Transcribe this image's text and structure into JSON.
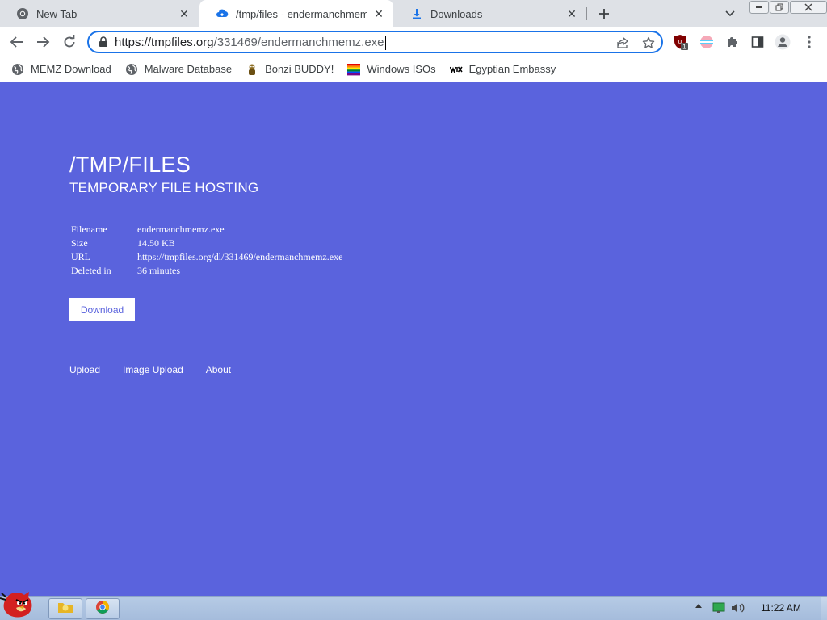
{
  "browser": {
    "tabs": [
      {
        "title": "New Tab",
        "icon": "chrome-icon"
      },
      {
        "title": "/tmp/files - endermanchmemz.exe",
        "icon": "cloud-upload-icon"
      },
      {
        "title": "Downloads",
        "icon": "download-icon"
      }
    ],
    "url_host": "https://tmpfiles.org",
    "url_path": "/331469/endermanchmemz.exe",
    "extension_badge": "1"
  },
  "bookmarks": [
    {
      "label": "MEMZ Download",
      "icon": "globe-icon"
    },
    {
      "label": "Malware Database",
      "icon": "globe-icon"
    },
    {
      "label": "Bonzi BUDDY!",
      "icon": "bonzi-icon"
    },
    {
      "label": "Windows ISOs",
      "icon": "rainbow-flag-icon"
    },
    {
      "label": "Egyptian Embassy",
      "icon": "wix-icon"
    }
  ],
  "page": {
    "title": "/TMP/FILES",
    "subtitle": "TEMPORARY FILE HOSTING",
    "file_info": [
      {
        "label": "Filename",
        "value": "endermanchmemz.exe"
      },
      {
        "label": "Size",
        "value": "14.50 KB"
      },
      {
        "label": "URL",
        "value": "https://tmpfiles.org/dl/331469/endermanchmemz.exe"
      },
      {
        "label": "Deleted in",
        "value": "36 minutes"
      }
    ],
    "download_label": "Download",
    "footer_links": [
      "Upload",
      "Image Upload",
      "About"
    ],
    "colors": {
      "background": "#5a63dd",
      "text": "#ffffff"
    }
  },
  "taskbar": {
    "time": "11:22 AM"
  }
}
